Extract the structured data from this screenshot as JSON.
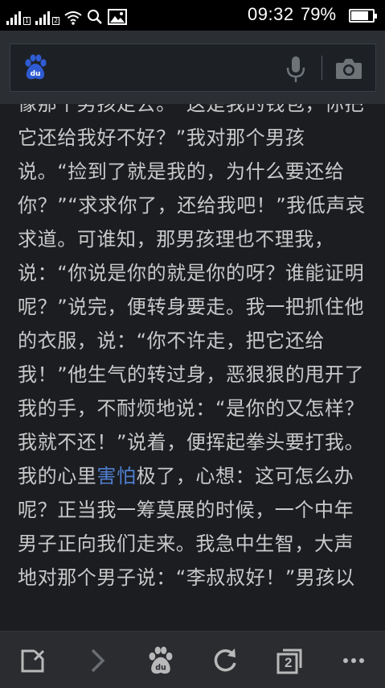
{
  "status_bar": {
    "time": "09:32",
    "battery_percent": "79%",
    "battery_level": 0.79
  },
  "search_bar": {
    "value": ""
  },
  "article": {
    "text_before_link": "像那个男孩走去。“这是我的钱包，你把它还给我好不好？”我对那个男孩说。“捡到了就是我的，为什么要还给你？”“求求你了，还给我吧！”我低声哀求道。可谁知，那男孩理也不理我，说：“你说是你的就是你的呀？谁能证明呢？”说完，便转身要走。我一把抓住他的衣服，说：“你不许走，把它还给我！”他生气的转过身，恶狠狠的甩开了我的手，不耐烦地说：“是你的又怎样？我就不还！”说着，便挥起拳头要打我。我的心里",
    "link_text": "害怕",
    "text_after_link": "极了，心想：这可怎么办呢？正当我一筹莫展的时候，一个中年男子正向我们走来。我急中生智，大声地对那个男子说：“李叔叔好！”男孩以"
  },
  "toolbar": {
    "tab_count": "2"
  },
  "icons": {
    "logo": "baidu-paw-icon",
    "voice": "microphone-icon",
    "image_search": "camera-icon",
    "close": "close-page-icon",
    "forward": "chevron-right-icon",
    "home": "baidu-paw-icon",
    "refresh": "refresh-icon",
    "tabs": "tabs-icon",
    "menu": "more-icon"
  },
  "colors": {
    "background": "#1b1d21",
    "text": "#c9c9c9",
    "link": "#4f7fd0",
    "header": "#2b2f34",
    "logo_blue": "#2f5bd3"
  }
}
